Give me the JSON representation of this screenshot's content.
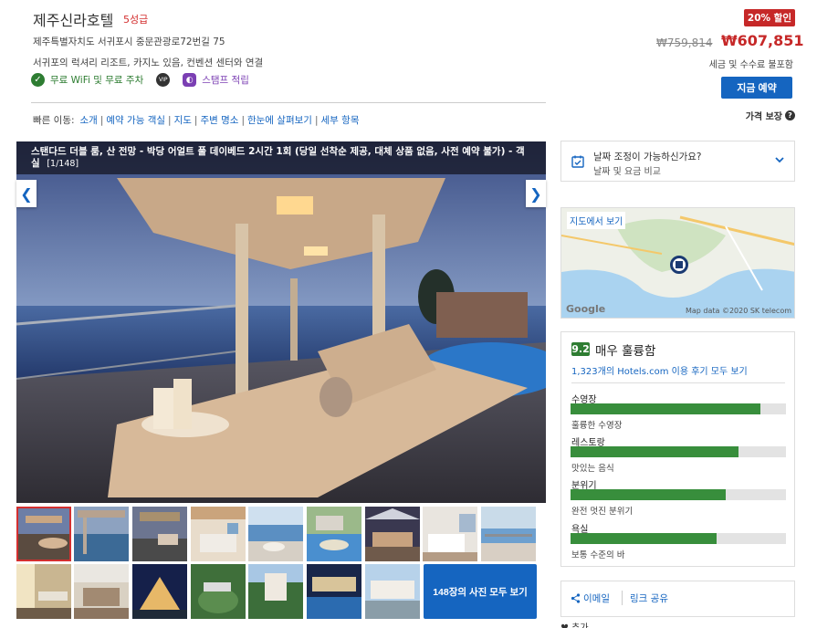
{
  "hotel": {
    "name": "제주신라호텔",
    "stars": "5성급",
    "address": "제주특별자치도 서귀포시 중문관광로72번길 75",
    "description": "서귀포의 럭셔리 리조트, 카지노 있음, 컨벤션 센터와 연결",
    "amenity_wifi": "무료 WiFi 및 무료 주차",
    "vip_label": "VIP",
    "amenity_stamp": "스탬프 적립"
  },
  "price": {
    "discount": "20% 할인",
    "original": "₩759,814",
    "current": "₩607,851",
    "tax_note": "세금 및 수수료 불포함",
    "book_label": "지금 예약",
    "guarantee": "가격 보장",
    "help_glyph": "?"
  },
  "quicknav": {
    "label": "빠른 이동:",
    "links": [
      "소개",
      "예약 가능 객실",
      "지도",
      "주변 명소",
      "한눈에 살펴보기",
      "세부 항목"
    ],
    "separator": "|"
  },
  "photo": {
    "caption": "스탠다드 더블 룸, 산 전망 - 박당 어얼트 풀 데이베드 2시간 1회 (당일 선착순 제공, 대체 상품 없음, 사전 예약 불가) - 객실",
    "counter": "[1/148]",
    "prev_glyph": "❮",
    "next_glyph": "❯",
    "all_photos_label": "148장의 사진 모두 보기"
  },
  "date_card": {
    "title": "날짜 조정이 가능하신가요?",
    "subtitle": "날짜 및 요금 비교",
    "chevron_glyph": "⌄"
  },
  "map": {
    "view_label": "지도에서 보기",
    "google": "Google",
    "credit": "Map data ©2020 SK telecom"
  },
  "reviews": {
    "score": "9.2",
    "label": "매우 훌륭함",
    "count_link": "1,323개의 Hotels.com 이용 후기 모두 보기",
    "categories": [
      {
        "name": "수영장",
        "level": 0.88,
        "desc": "훌륭한 수영장"
      },
      {
        "name": "레스토랑",
        "level": 0.78,
        "desc": "맛있는 음식"
      },
      {
        "name": "분위기",
        "level": 0.72,
        "desc": "완전 멋진 분위기"
      },
      {
        "name": "욕실",
        "level": 0.68,
        "desc": "보통 수준의 바"
      }
    ]
  },
  "share": {
    "email": "이메일",
    "copy_link": "링크 공유",
    "favorite": "♥ 추가"
  },
  "colors": {
    "brand_blue": "#1565c0",
    "price_red": "#c62828",
    "score_green": "#2e7d32"
  }
}
